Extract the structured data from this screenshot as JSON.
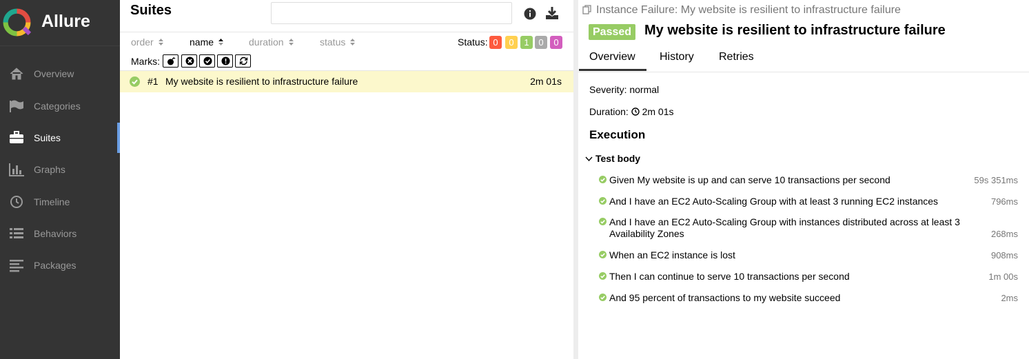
{
  "app": {
    "name": "Allure"
  },
  "sidebar": {
    "items": [
      {
        "label": "Overview",
        "icon": "home-icon",
        "active": false
      },
      {
        "label": "Categories",
        "icon": "flag-icon",
        "active": false
      },
      {
        "label": "Suites",
        "icon": "briefcase-icon",
        "active": true
      },
      {
        "label": "Graphs",
        "icon": "bar-chart-icon",
        "active": false
      },
      {
        "label": "Timeline",
        "icon": "clock-icon",
        "active": false
      },
      {
        "label": "Behaviors",
        "icon": "list-icon",
        "active": false
      },
      {
        "label": "Packages",
        "icon": "align-left-icon",
        "active": false
      }
    ]
  },
  "suites": {
    "title": "Suites",
    "search": {
      "value": "",
      "placeholder": ""
    },
    "columns": [
      "order",
      "name",
      "duration",
      "status"
    ],
    "status_label": "Status:",
    "status_counts": [
      {
        "value": "0",
        "color": "#fd5a3e"
      },
      {
        "value": "0",
        "color": "#ffd050"
      },
      {
        "value": "1",
        "color": "#97cc64"
      },
      {
        "value": "0",
        "color": "#aaaaaa"
      },
      {
        "value": "0",
        "color": "#d35ebe"
      }
    ],
    "marks_label": "Marks:",
    "marks": [
      "flaky-icon",
      "new-failed-icon",
      "new-passed-icon",
      "new-broken-icon",
      "retries-icon"
    ],
    "rows": [
      {
        "order": "#1",
        "name": "My website is resilient to infrastructure failure",
        "duration": "2m 01s",
        "status": "passed"
      }
    ]
  },
  "detail": {
    "breadcrumb": "Instance Failure: My website is resilient to infrastructure failure",
    "status": "Passed",
    "title": "My website is resilient to infrastructure failure",
    "tabs": [
      "Overview",
      "History",
      "Retries"
    ],
    "active_tab": "Overview",
    "severity": "Severity: normal",
    "duration_label": "Duration:",
    "duration_value": "2m 01s",
    "section_title": "Execution",
    "test_body_label": "Test body",
    "steps": [
      {
        "text": "Given My website is up and can serve 10 transactions per second",
        "duration": "59s 351ms"
      },
      {
        "text": "And I have an EC2 Auto-Scaling Group with at least 3 running EC2 instances",
        "duration": "796ms"
      },
      {
        "text": "And I have an EC2 Auto-Scaling Group with instances distributed across at least 3 Availability Zones",
        "duration": "268ms"
      },
      {
        "text": "When an EC2 instance is lost",
        "duration": "908ms"
      },
      {
        "text": "Then I can continue to serve 10 transactions per second",
        "duration": "1m 00s"
      },
      {
        "text": "And 95 percent of transactions to my website succeed",
        "duration": "2ms"
      }
    ]
  },
  "colors": {
    "sidebar_bg": "#343434",
    "passed": "#97cc64",
    "row_highlight": "#fcf8cc",
    "active_indicator": "#6a9ee4"
  }
}
